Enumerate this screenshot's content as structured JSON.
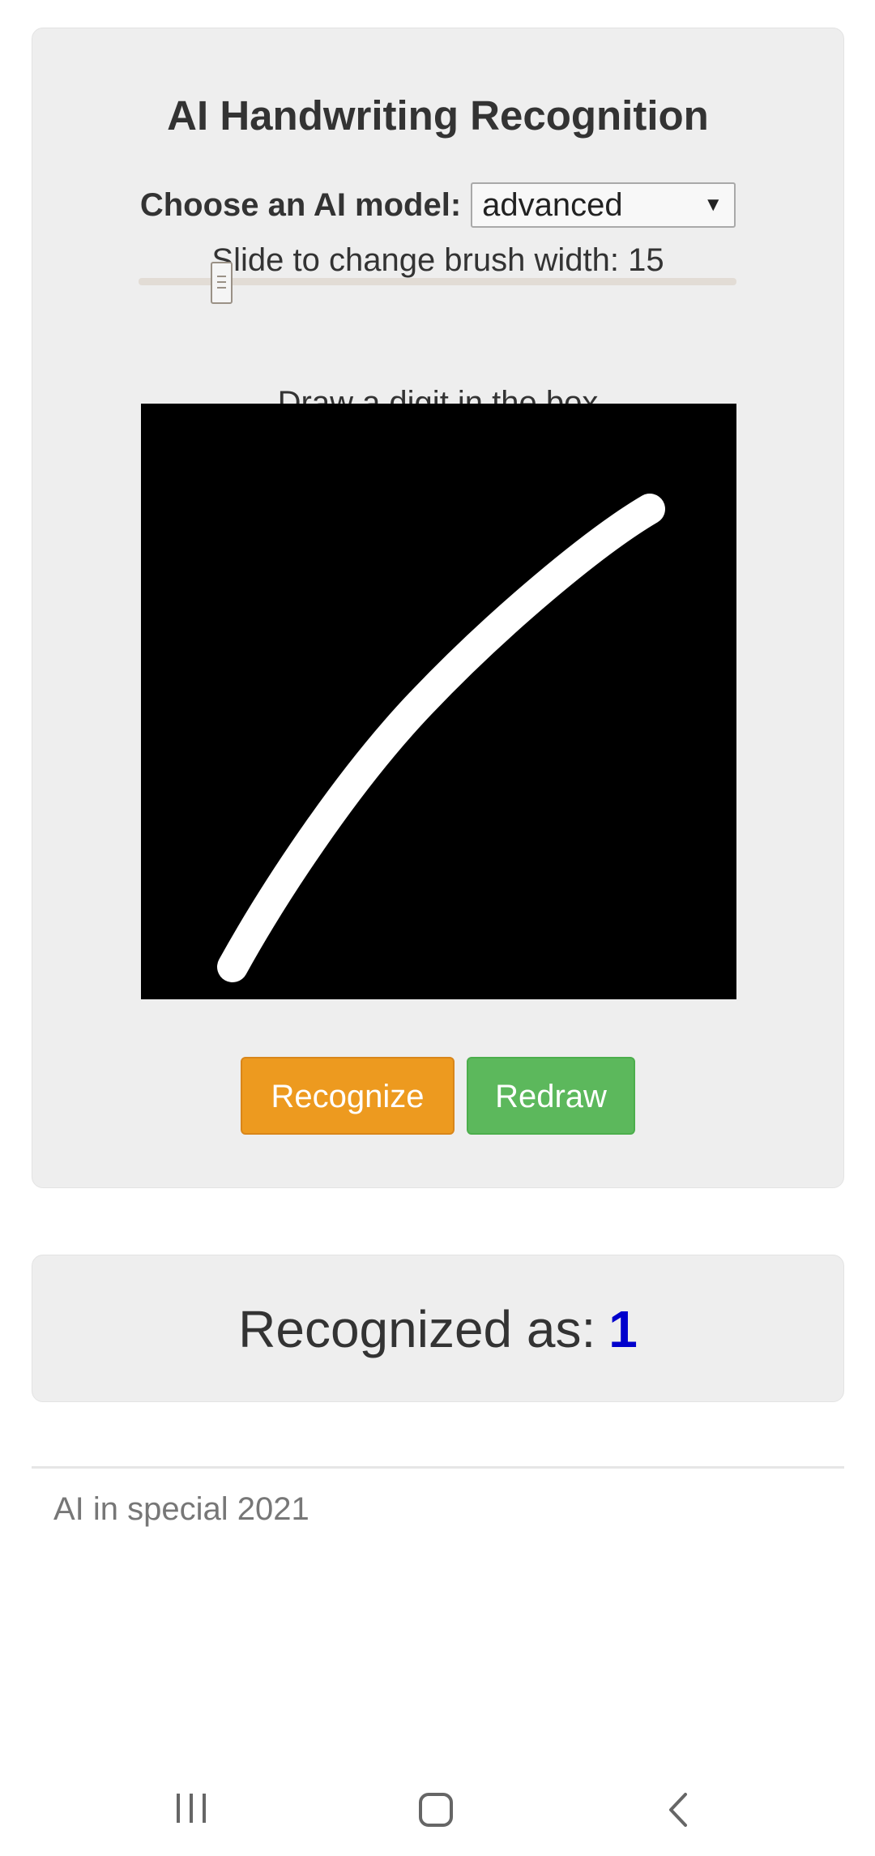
{
  "main": {
    "title": "AI Handwriting Recognition",
    "model_label": "Choose an AI model:",
    "model_selected": "advanced",
    "slider_label": "Slide to change brush width: 15",
    "brush_width": 15,
    "draw_label": "Draw a digit in the box",
    "canvas_bg": "#000000",
    "stroke_color": "#ffffff",
    "recognize_label": "Recognize",
    "redraw_label": "Redraw"
  },
  "result": {
    "label": "Recognized as:",
    "value": "1"
  },
  "footer": {
    "text": "AI in special 2021"
  },
  "colors": {
    "recognize": "#ed9a1f",
    "redraw": "#5cb85c",
    "result_value": "#0000cc"
  },
  "nav": {
    "items": [
      "recent-apps-icon",
      "home-icon",
      "back-icon"
    ]
  }
}
